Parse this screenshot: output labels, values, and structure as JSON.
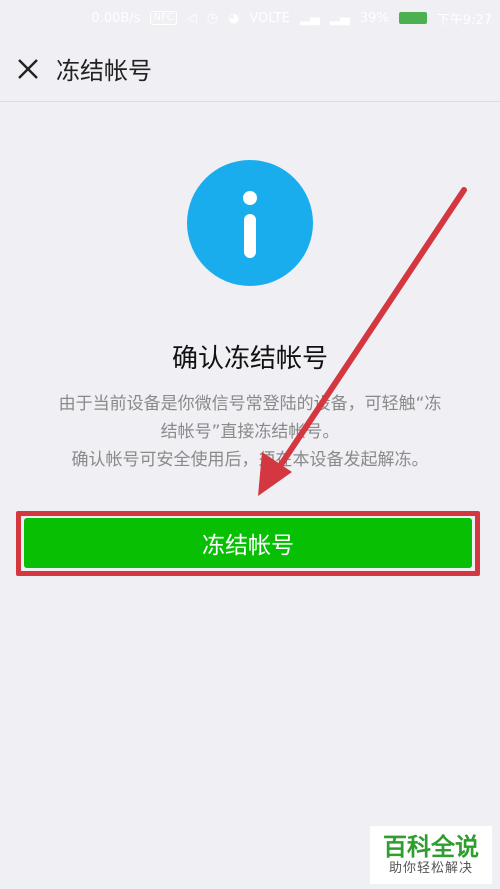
{
  "status_bar": {
    "speed": "0.00B/s",
    "nfc": "NFC",
    "network": "VOLTE",
    "battery_percent": "39%",
    "time": "下午9:27"
  },
  "nav": {
    "title": "冻结帐号"
  },
  "main": {
    "heading": "确认冻结帐号",
    "description_line1": "由于当前设备是你微信号常登陆的设备，可轻触“冻",
    "description_line2": "结帐号”直接冻结帐号。",
    "description_line3": "确认帐号可安全使用后，须在本设备发起解冻。",
    "button_label": "冻结帐号"
  },
  "watermark": {
    "title": "百科全说",
    "subtitle": "助你轻松解决"
  },
  "colors": {
    "background": "#efeff4",
    "info_blue": "#1aadee",
    "button_green": "#07c003",
    "annotation_red": "#d4373f",
    "watermark_green": "#2e9e2e"
  }
}
